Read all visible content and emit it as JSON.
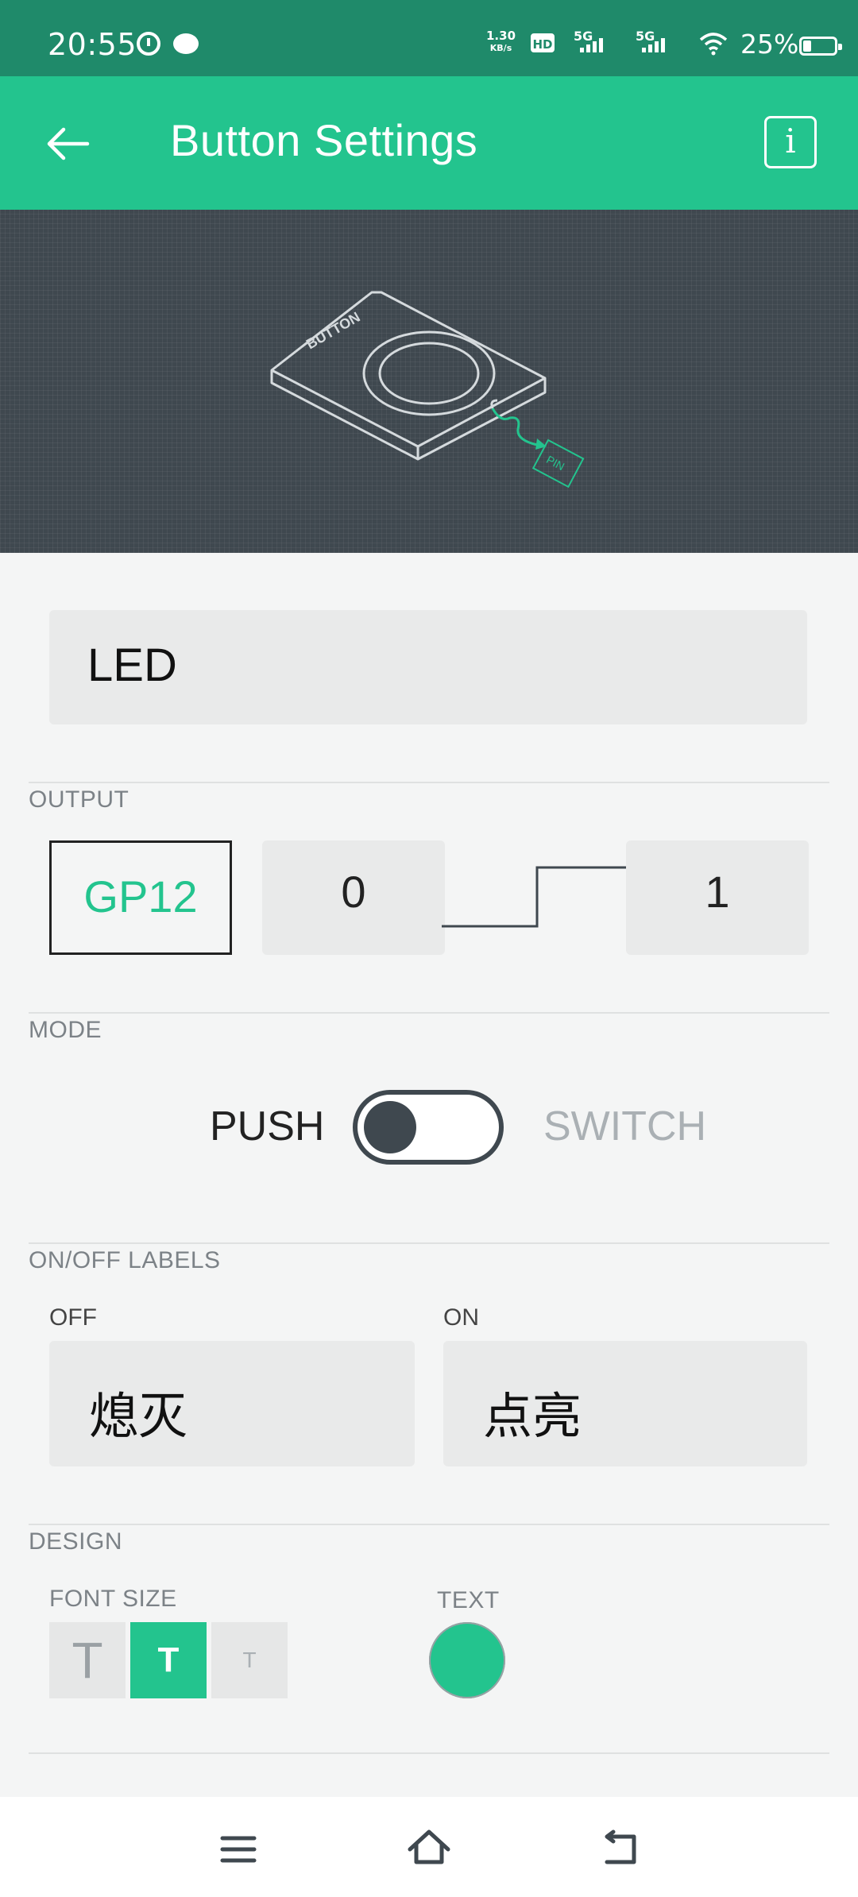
{
  "status_bar": {
    "time": "20:55",
    "net_speed_value": "1.30",
    "net_speed_unit": "KB/s",
    "hd_label": "HD",
    "sim1_label": "5G",
    "sim2_label": "5G",
    "battery_percent": "25%"
  },
  "app_bar": {
    "title": "Button Settings",
    "info_label": "i"
  },
  "hero": {
    "button_label": "BUTTON",
    "pin_label": "PIN"
  },
  "name_field": {
    "value": "LED"
  },
  "output": {
    "section_label": "OUTPUT",
    "pin": "GP12",
    "low_value": "0",
    "high_value": "1"
  },
  "mode": {
    "section_label": "MODE",
    "push_label": "PUSH",
    "switch_label": "SWITCH",
    "selected": "PUSH"
  },
  "labels": {
    "section_label": "ON/OFF LABELS",
    "off_label": "OFF",
    "on_label": "ON",
    "off_value": "熄灭",
    "on_value": "点亮"
  },
  "design": {
    "section_label": "DESIGN",
    "font_size_label": "FONT SIZE",
    "font_options": [
      "T",
      "T",
      "T"
    ],
    "selected_font_index": 1,
    "text_color_label": "TEXT",
    "text_color": "#23c48e"
  },
  "colors": {
    "accent": "#23c48e",
    "status_bar": "#1f8a6a",
    "hero_bg": "#3f484f"
  },
  "nav_icons": [
    "menu-icon",
    "home-icon",
    "back-icon"
  ]
}
